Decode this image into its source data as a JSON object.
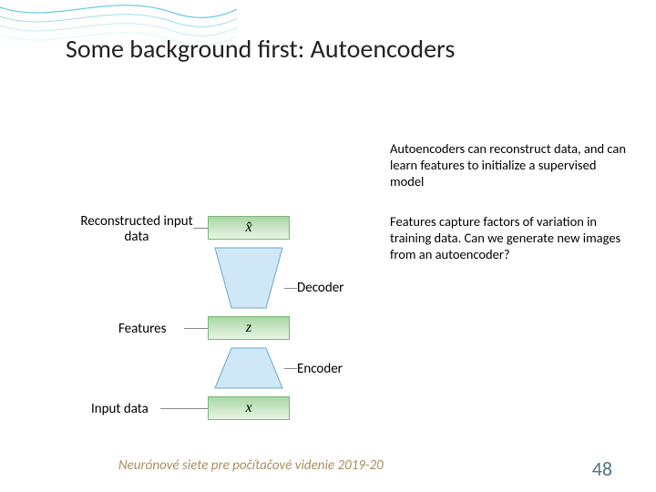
{
  "title": "Some background first: Autoencoders",
  "para1": "Autoencoders can reconstruct data, and can learn features to initialize a supervised model",
  "para2": "Features capture factors of variation in training data. Can we generate new images from an autoencoder?",
  "labels": {
    "reconstructed": "Reconstructed input data",
    "decoder": "Decoder",
    "features": "Features",
    "encoder": "Encoder",
    "input": "Input data"
  },
  "vars": {
    "xhat": "x̂",
    "z": "z",
    "x": "x"
  },
  "footer": "Neurónové siete pre počítačové videnie 2019-20",
  "page": "48"
}
